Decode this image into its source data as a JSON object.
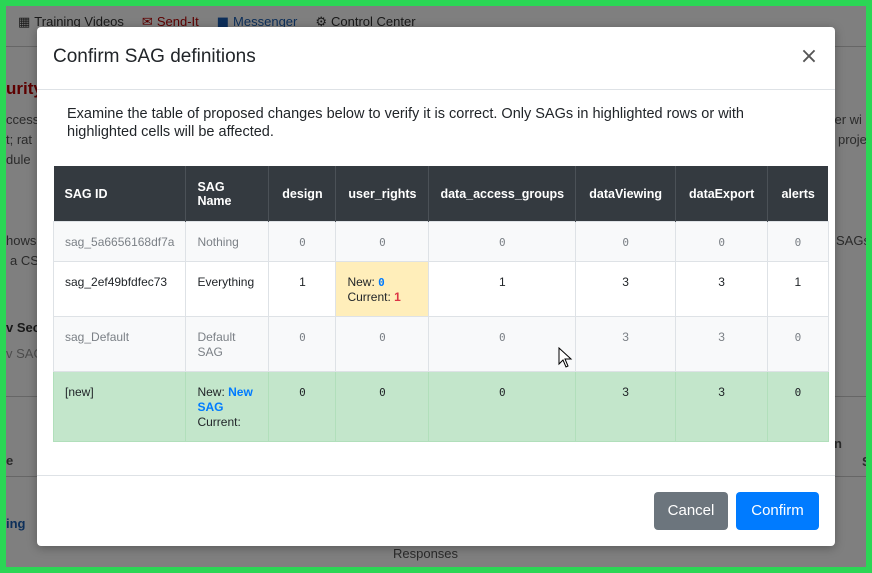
{
  "background": {
    "nav": [
      {
        "icon": "film-icon",
        "glyph": "▦",
        "label": "Training Videos"
      },
      {
        "icon": "envelope-icon",
        "glyph": "✉",
        "label": "Send-It"
      },
      {
        "icon": "messenger-icon",
        "glyph": "■",
        "label": "Messenger"
      },
      {
        "icon": "gear-icon",
        "glyph": "⚙",
        "label": "Control Center"
      }
    ],
    "fragments": {
      "title": "urity",
      "line1": "ccess G",
      "line2": "t; rat",
      "line3": "dule",
      "line4": "hows",
      "line5": "a CS",
      "line6": "v Sec",
      "line7": "v SAG",
      "line8": "e",
      "line9": "ing",
      "right1": "ser wi",
      "right2": "proje",
      "right3": "SAGs",
      "right4": "n",
      "right5": "S",
      "bottom": "Responses"
    }
  },
  "modal": {
    "title": "Confirm SAG definitions",
    "close_glyph": "×",
    "intro": "Examine the table of proposed changes below to verify it is correct. Only SAGs in highlighted rows or with highlighted cells will be affected.",
    "columns": [
      "SAG ID",
      "SAG Name",
      "design",
      "user_rights",
      "data_access_groups",
      "dataViewing",
      "dataExport",
      "alerts"
    ],
    "rows": [
      {
        "id": "sag_5a6656168df7a",
        "name": "Nothing",
        "design": "0",
        "user_rights": "0",
        "data_access_groups": "0",
        "dataViewing": "0",
        "dataExport": "0",
        "alerts": "0"
      },
      {
        "id": "sag_2ef49bfdfec73",
        "name": "Everything",
        "design": "1",
        "user_rights_new_label": "New:",
        "user_rights_new": "0",
        "user_rights_cur_label": "Current:",
        "user_rights_cur": "1",
        "data_access_groups": "1",
        "dataViewing": "3",
        "dataExport": "3",
        "alerts": "1"
      },
      {
        "id": "sag_Default",
        "name": "Default SAG",
        "design": "0",
        "user_rights": "0",
        "data_access_groups": "0",
        "dataViewing": "3",
        "dataExport": "3",
        "alerts": "0"
      },
      {
        "id": "[new]",
        "name_new_label": "New:",
        "name_new": "New SAG",
        "name_cur_label": "Current:",
        "design": "0",
        "user_rights": "0",
        "data_access_groups": "0",
        "dataViewing": "3",
        "dataExport": "3",
        "alerts": "0"
      }
    ],
    "buttons": {
      "cancel": "Cancel",
      "confirm": "Confirm"
    }
  },
  "colors": {
    "frame_border": "#2bd655",
    "header_bg": "#343a40",
    "highlight_cell": "#ffeeba",
    "new_row": "#c3e6cb",
    "new_value": "#007bff",
    "current_value": "#dc3545",
    "cancel_btn": "#6c757d",
    "confirm_btn": "#007bff"
  }
}
